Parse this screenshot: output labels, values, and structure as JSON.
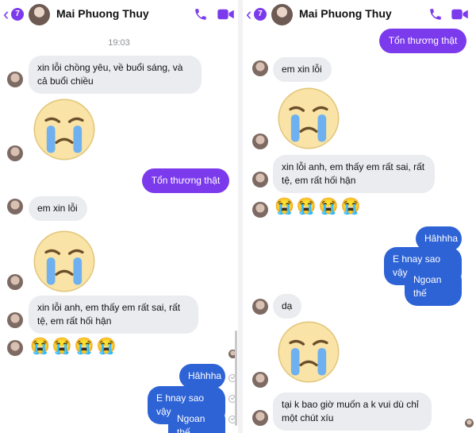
{
  "header": {
    "back_badge": "7",
    "contact_name": "Mai Phuong Thuy",
    "colors": {
      "accent": "#7c3aed"
    }
  },
  "left": {
    "timestamp": "19:03",
    "messages": {
      "m1": "xin lỗi chồng yêu, về buổi sáng, và cả buổi chiều",
      "m2": "Tổn thương thật",
      "m3": "em xin lỗi",
      "m4": "xin lỗi anh, em thấy em rất sai, rất tệ, em rất hối hận",
      "m5_emojis": "😭😭😭😭",
      "m6": "Hâhhha",
      "m7": "E hnay sao vậy",
      "m8": "Ngoan thế"
    }
  },
  "right": {
    "messages": {
      "r1": "Tổn thương thật",
      "r2": "em xin lỗi",
      "r3": "xin lỗi anh, em thấy em rất sai, rất tệ, em rất hối hận",
      "r4_emojis": "😭😭😭😭",
      "r5": "Hâhhha",
      "r6": "E hnay sao vậy",
      "r7": "Ngoan thế",
      "r8": "dạ",
      "r9": "tại k bao giờ muốn a k vui dù chỉ một chút xíu"
    }
  },
  "icons": [
    "chevron-left-icon",
    "phone-icon",
    "video-camera-icon",
    "crying-face-icon",
    "loudly-crying-emoji",
    "delivered-check-icon"
  ]
}
